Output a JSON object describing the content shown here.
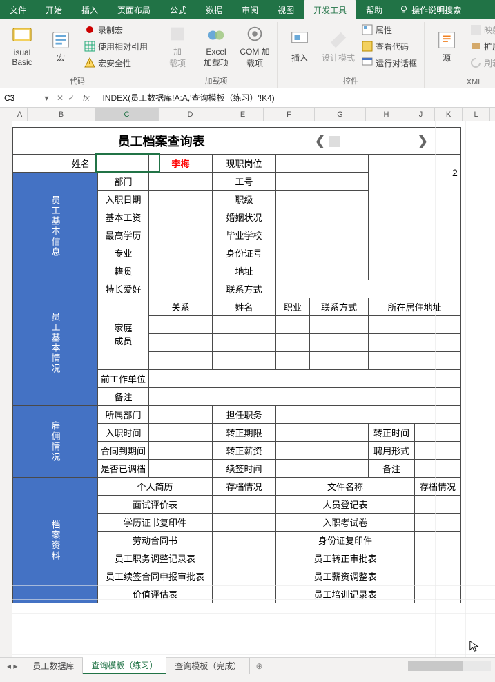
{
  "ribbon": {
    "tabs": [
      "文件",
      "开始",
      "插入",
      "页面布局",
      "公式",
      "数据",
      "审阅",
      "视图",
      "开发工具",
      "帮助"
    ],
    "active_tab_index": 8,
    "tell_me": "操作说明搜索",
    "groups": {
      "code": {
        "label": "代码",
        "visual_basic": "isual Basic",
        "macro": "宏",
        "record_macro": "录制宏",
        "relative_ref": "使用相对引用",
        "macro_security": "宏安全性"
      },
      "addins": {
        "label": "加载项",
        "addins": "加\n载项",
        "excel_addins": "Excel\n加载项",
        "com_addins": "COM 加载项"
      },
      "controls": {
        "label": "控件",
        "insert": "插入",
        "design_mode": "设计模式",
        "properties": "属性",
        "view_code": "查看代码",
        "run_dialog": "运行对话框"
      },
      "xml": {
        "label": "XML",
        "source": "源",
        "map_props": "映射属性",
        "expand_pack": "扩展包",
        "refresh_data": "刷新数据"
      }
    }
  },
  "formula_bar": {
    "name_box": "C3",
    "formula": "=INDEX(员工数据库!A:A,'查询模板（练习）'!K4)"
  },
  "columns": [
    "A",
    "B",
    "C",
    "D",
    "E",
    "F",
    "G",
    "H",
    "J",
    "K",
    "L"
  ],
  "sheet": {
    "title": "员工档案查询表",
    "name_label": "姓名",
    "name_value": "李梅",
    "cur_pos_label": "现职岗位",
    "sections": {
      "basic_info": {
        "header": "员工基本信息",
        "rows": [
          [
            "部门",
            "",
            "工号",
            ""
          ],
          [
            "入职日期",
            "",
            "职级",
            ""
          ],
          [
            "基本工资",
            "",
            "婚姻状况",
            ""
          ],
          [
            "最高学历",
            "",
            "毕业学校",
            ""
          ],
          [
            "专业",
            "",
            "身份证号",
            ""
          ],
          [
            "籍贯",
            "",
            "地址",
            ""
          ]
        ]
      },
      "basic_situation": {
        "header": "员工基本情况",
        "hobby": "特长爱好",
        "contact": "联系方式",
        "family": "家庭\n成员",
        "family_cols": [
          "关系",
          "姓名",
          "职业",
          "联系方式",
          "所在居住地址"
        ],
        "prev_work": "前工作单位",
        "remark": "备注"
      },
      "employment": {
        "header": "雇佣情况",
        "rows": [
          [
            "所属部门",
            "",
            "担任职务",
            "",
            "",
            ""
          ],
          [
            "入职时间",
            "",
            "转正期限",
            "",
            "转正时间",
            ""
          ],
          [
            "合同到期间",
            "",
            "转正薪资",
            "",
            "聘用形式",
            ""
          ],
          [
            "是否已调档",
            "",
            "续签时间",
            "",
            "备注",
            ""
          ]
        ]
      },
      "archive": {
        "header": "档案资料",
        "cols": [
          "个人简历",
          "存档情况",
          "文件名称",
          "存档情况"
        ],
        "rows": [
          [
            "面试评价表",
            "",
            "人员登记表",
            ""
          ],
          [
            "学历证书复印件",
            "",
            "入职考试卷",
            ""
          ],
          [
            "劳动合同书",
            "",
            "身份证复印件",
            ""
          ],
          [
            "员工职务调整记录表",
            "",
            "员工转正审批表",
            ""
          ],
          [
            "员工续签合同申报审批表",
            "",
            "员工薪资调整表",
            ""
          ],
          [
            "价值评估表",
            "",
            "员工培训记录表",
            ""
          ]
        ]
      }
    },
    "k2_value": "2"
  },
  "sheet_tabs": {
    "tabs": [
      "员工数据库",
      "查询模板（练习）",
      "查询模板（完成）"
    ],
    "active_index": 1
  }
}
